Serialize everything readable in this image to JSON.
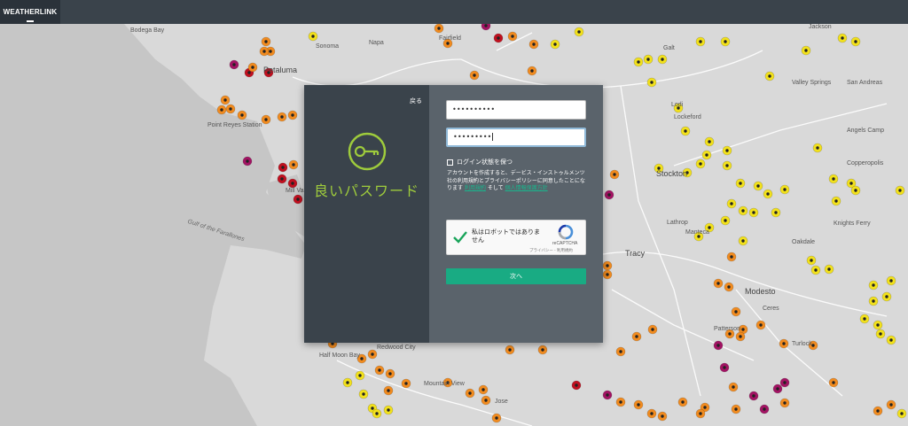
{
  "app": {
    "brand": "WEATHERLINK"
  },
  "map": {
    "labels": [
      "Bodega Bay",
      "Sonoma",
      "Napa",
      "Fairfield",
      "Petaluma",
      "Point Reyes Station",
      "Mill Valley",
      "Gulf of the Farallones",
      "Half Moon Bay",
      "Redwood City",
      "Mountain View",
      "Jose",
      "Galt",
      "Jackson",
      "Valley Springs",
      "San Andreas",
      "Lockeford",
      "Angels Camp",
      "Copperopolis",
      "Stockton",
      "Lathrop",
      "Manteca",
      "Knights Ferry",
      "Oakdale",
      "Tracy",
      "Modesto",
      "Ceres",
      "Turlock",
      "Patterson",
      "Lodi"
    ],
    "colors": {
      "orange": "#f18b1f",
      "yellow": "#f2e11c",
      "magenta": "#a21363",
      "red": "#c0101f"
    }
  },
  "modal": {
    "back_label": "戻る",
    "hero_text": "良いパスワード",
    "icon": "key-icon",
    "password_value": "••••••••••",
    "confirm_value": "•••••••••",
    "remember_label": "ログイン状態を保つ",
    "terms_text": "アカウントを作成すると、デービス・インストゥルメンツ社の利用規約とプライバシーポリシーに同意したことになります",
    "terms_link": "利用規約",
    "terms_and": "そして",
    "privacy_link": "個人情報保護方針",
    "captcha_label": "私はロボットではありません",
    "captcha_brand": "reCAPTCHA",
    "captcha_links": "プライバシー - 利用規約",
    "next_label": "次へ"
  }
}
